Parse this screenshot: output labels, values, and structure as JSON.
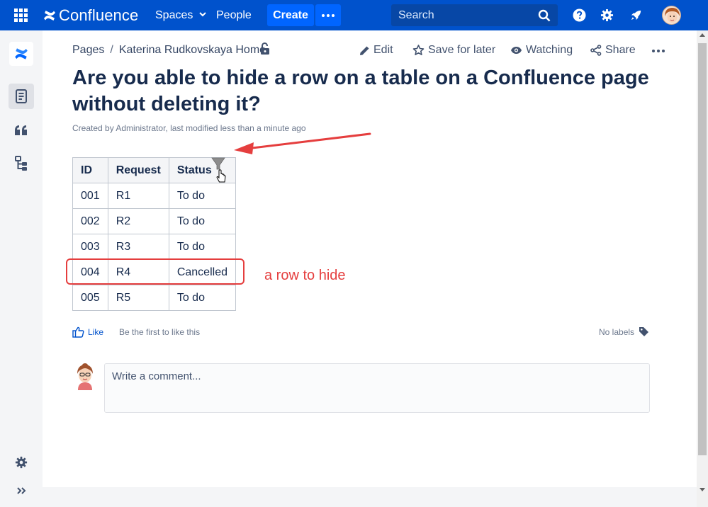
{
  "topnav": {
    "logo_text": "Confluence",
    "spaces_label": "Spaces",
    "people_label": "People",
    "create_label": "Create",
    "search_placeholder": "Search",
    "brand_color": "#0052cc"
  },
  "sidebar": {
    "items": [
      {
        "icon": "pages-icon"
      },
      {
        "icon": "quote-icon"
      },
      {
        "icon": "hierarchy-icon"
      },
      {
        "icon": "gear-icon"
      },
      {
        "icon": "expand-icon"
      }
    ]
  },
  "breadcrumb": {
    "root": "Pages",
    "separator": "/",
    "parent": "Katerina Rudkovskaya Home"
  },
  "actions": {
    "edit": "Edit",
    "save": "Save for later",
    "watch": "Watching",
    "share": "Share"
  },
  "page": {
    "title": "Are you able to hide a row on a table on a Confluence page without deleting it?",
    "byline": "Created by Administrator, last modified less than a minute ago"
  },
  "table": {
    "headers": [
      "ID",
      "Request",
      "Status"
    ],
    "rows": [
      [
        "001",
        "R1",
        "To do"
      ],
      [
        "002",
        "R2",
        "To do"
      ],
      [
        "003",
        "R3",
        "To do"
      ],
      [
        "004",
        "R4",
        "Cancelled"
      ],
      [
        "005",
        "R5",
        "To do"
      ]
    ]
  },
  "annotation": {
    "note": "a row to hide",
    "color": "#e53e3e"
  },
  "footer": {
    "like_label": "Like",
    "like_text": "Be the first to like this",
    "labels_text": "No labels",
    "comment_placeholder": "Write a comment..."
  }
}
